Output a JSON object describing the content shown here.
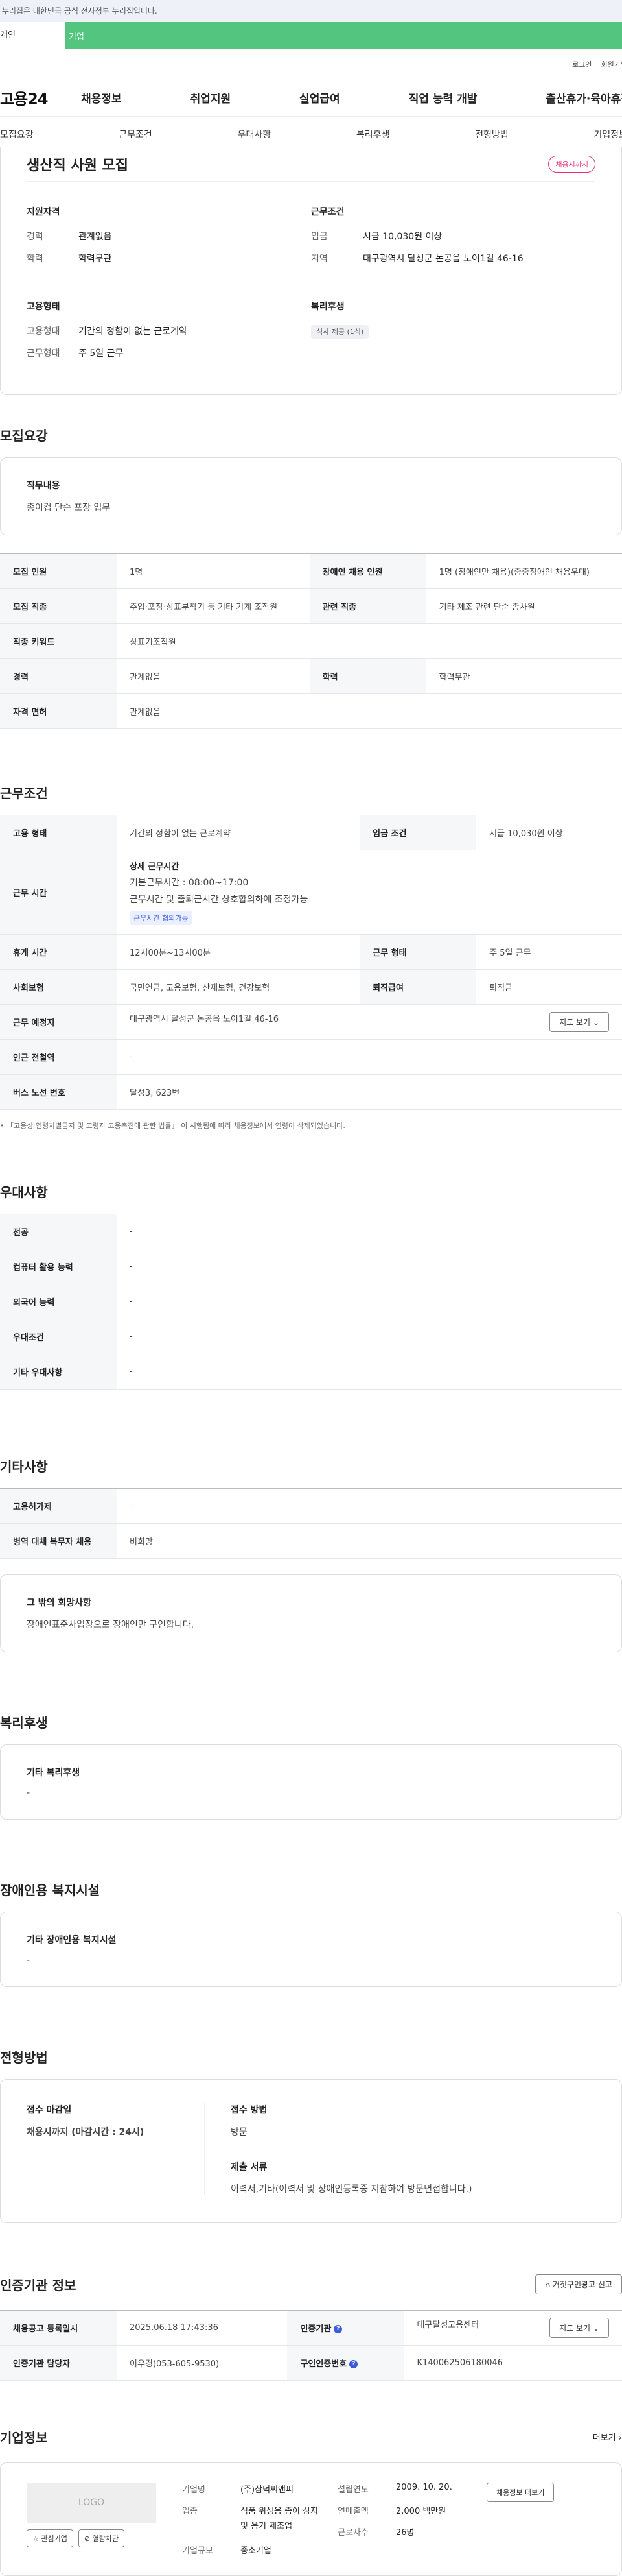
{
  "banner": "이 누리집은 대한민국 공식 전자정부 누리집입니다.",
  "topbar": {
    "tab1": "개인",
    "tab2": "기업"
  },
  "util": {
    "login": "로그인",
    "join": "회원가입"
  },
  "gnb": {
    "logo": "고용24",
    "items": [
      "채용정보",
      "취업지원",
      "실업급여",
      "직업 능력 개발",
      "출산휴가·육아휴직"
    ]
  },
  "subnav": [
    "모집요강",
    "근무조건",
    "우대사항",
    "복리후생",
    "전형방법",
    "기업정보"
  ],
  "hero": {
    "title": "생산직 사원 모집",
    "badge": "채용시까지",
    "qual_h": "지원자격",
    "exp_k": "경력",
    "exp_v": "관계없음",
    "edu_k": "학력",
    "edu_v": "학력무관",
    "cond_h": "근무조건",
    "wage_k": "임금",
    "wage_v": "시급 10,030원 이상",
    "loc_k": "지역",
    "loc_v": "대구광역시 달성군 논공읍 노이1길 46-16",
    "emp_h": "고용형태",
    "type_k": "고용형태",
    "type_v": "기간의 정함이 없는 근로계약",
    "work_k": "근무형태",
    "work_v": "주 5일 근무",
    "welfare_h": "복리후생",
    "welfare_chip": "식사 제공 (1식)"
  },
  "recruit": {
    "title": "모집요강",
    "job_h": "직무내용",
    "job_v": "종이컵 단순 포장 업무",
    "rows": [
      {
        "k1": "모집 인원",
        "v1": "1명",
        "k2": "장애인 채용 인원",
        "v2": "1명 (장애인만 채용)(중증장애인 채용우대)"
      },
      {
        "k1": "모집 직종",
        "v1": "주입·포장·상표부착기 등 기타 기계 조작원",
        "k2": "관련 직종",
        "v2": "기타 제조 관련 단순 종사원"
      },
      {
        "k1": "직종 키워드",
        "v1": "상표기조작원"
      },
      {
        "k1": "경력",
        "v1": "관계없음",
        "k2": "학력",
        "v2": "학력무관"
      },
      {
        "k1": "자격 면허",
        "v1": "관계없음"
      }
    ]
  },
  "conditions": {
    "title": "근무조건",
    "type_k": "고용 형태",
    "type_v": "기간의 정함이 없는 근로계약",
    "wage_k": "임금 조건",
    "wage_v": "시급 10,030원 이상",
    "time_k": "근무 시간",
    "time_h": "상세 근무시간",
    "time_1": "기본근무시간 : 08:00~17:00",
    "time_2": "근무시간 및 출퇴근시간 상호합의하에 조정가능",
    "time_chip": "근무시간 협의가능",
    "rest_k": "휴게 시간",
    "rest_v": "12시00분~13시00분",
    "form_k": "근무 형태",
    "form_v": "주 5일 근무",
    "ins_k": "사회보험",
    "ins_v": "국민연금, 고용보험, 산재보험, 건강보험",
    "ret_k": "퇴직급여",
    "ret_v": "퇴직금",
    "place_k": "근무 예정지",
    "place_v": "대구광역시 달성군 논공읍 노이1길 46-16",
    "map_btn": "지도 보기",
    "sub_k": "인근 전철역",
    "sub_v": "-",
    "bus_k": "버스 노선 번호",
    "bus_v": "달성3, 623번",
    "note": "「고용상 연령차별금지 및 고령자 고용촉진에 관한 법률」 이 시행됨에 따라 채용정보에서 연령이 삭제되었습니다."
  },
  "pref": {
    "title": "우대사항",
    "rows": [
      {
        "k": "전공",
        "v": "-"
      },
      {
        "k": "컴퓨터 활용 능력",
        "v": "-"
      },
      {
        "k": "외국어 능력",
        "v": "-"
      },
      {
        "k": "우대조건",
        "v": "-"
      },
      {
        "k": "기타 우대사항",
        "v": "-"
      }
    ]
  },
  "etc": {
    "title": "기타사항",
    "rows": [
      {
        "k": "고용허가제",
        "v": "-"
      },
      {
        "k": "병역 대체 복무자 채용",
        "v": "비희망"
      }
    ],
    "box_h": "그 밖의 희망사항",
    "box_v": "장애인표준사업장으로 장애인만 구인합니다."
  },
  "welfare": {
    "title": "복리후생",
    "box_h": "기타 복리후생",
    "box_v": "-"
  },
  "disab": {
    "title": "장애인용 복지시설",
    "box_h": "기타 장애인용 복지시설",
    "box_v": "-"
  },
  "selection": {
    "title": "전형방법",
    "deadline_h": "접수 마감일",
    "deadline_v": "채용시까지 (마감시간 : 24시)",
    "method_h": "접수 방법",
    "method_v": "방문",
    "docs_h": "제출 서류",
    "docs_v": "이력서,기타(이력서 및 장애인등록증 지참하여 방문면접합니다.)"
  },
  "cert": {
    "title": "인증기관 정보",
    "report_btn": "거짓구인광고 신고",
    "reg_k": "채용공고 등록일시",
    "reg_v": "2025.06.18 17:43:36",
    "org_k": "인증기관",
    "org_v": "대구달성고용센터",
    "map_btn": "지도 보기",
    "mgr_k": "인증기관 담당자",
    "mgr_v": "이우경(053-605-9530)",
    "num_k": "구인인증번호",
    "num_v": "K140062506180046"
  },
  "company": {
    "title": "기업정보",
    "more": "더보기",
    "logo": "LOGO",
    "fav_btn": "관심기업",
    "block_btn": "열람차단",
    "name_k": "기업명",
    "name_v": "(주)삼덕씨앤피",
    "ind_k": "업종",
    "ind_v": "식품 위생용 종이 상자 및 용기 제조업",
    "size_k": "기업규모",
    "size_v": "중소기업",
    "est_k": "설립연도",
    "est_v": "2009. 10. 20.",
    "rev_k": "연매출액",
    "rev_v": "2,000 백만원",
    "emp_k": "근로자수",
    "emp_v": "26명",
    "jobs_btn": "채용정보 더보기"
  }
}
